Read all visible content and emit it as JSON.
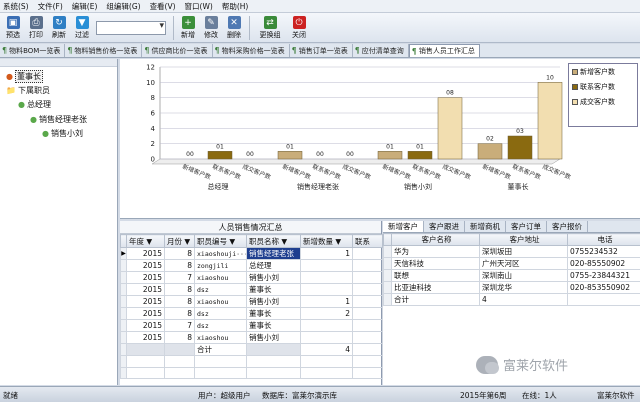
{
  "menu": [
    "系统(S)",
    "文件(F)",
    "编辑(E)",
    "组编辑(G)",
    "查看(V)",
    "窗口(W)",
    "帮助(H)"
  ],
  "toolbar": [
    {
      "label": "预选",
      "icon": "preview-icon",
      "color": "#3b6fb5"
    },
    {
      "label": "打印",
      "icon": "printer-icon",
      "color": "#5a6f8c"
    },
    {
      "label": "刷新",
      "icon": "refresh-icon",
      "color": "#2f7fc4"
    },
    {
      "label": "过滤",
      "icon": "filter-icon",
      "color": "#2a8fd6"
    },
    {
      "label": "新增",
      "icon": "add-icon",
      "color": "#3b8f3b"
    },
    {
      "label": "修改",
      "icon": "edit-icon",
      "color": "#6a7f9c"
    },
    {
      "label": "删除",
      "icon": "delete-icon",
      "color": "#4f79b3"
    },
    {
      "label": "更换组",
      "icon": "swap-group-icon",
      "color": "#3a8a3a"
    },
    {
      "label": "关闭",
      "icon": "close-icon",
      "color": "#cc2222"
    }
  ],
  "tabs": [
    {
      "label": "物料BOM一览表",
      "active": false
    },
    {
      "label": "物料销售价格一览表",
      "active": false
    },
    {
      "label": "供应商比价一览表",
      "active": false
    },
    {
      "label": "物料采购价格一览表",
      "active": false
    },
    {
      "label": "销售订单一览表",
      "active": false
    },
    {
      "label": "应付清单查询",
      "active": false
    },
    {
      "label": "销售人员工作汇总",
      "active": true
    }
  ],
  "tree": [
    {
      "label": "董事长",
      "level": 0,
      "selected": true
    },
    {
      "label": "下属职员",
      "level": 0,
      "selected": false
    },
    {
      "label": "总经理",
      "level": 1,
      "selected": false
    },
    {
      "label": "销售经理老张",
      "level": 2,
      "selected": false
    },
    {
      "label": "销售小刘",
      "level": 3,
      "selected": false
    }
  ],
  "chart_data": {
    "type": "bar",
    "ylim": [
      0,
      12
    ],
    "yticks": [
      0,
      2,
      4,
      6,
      8,
      10,
      12
    ],
    "categories": [
      "总经理",
      "销售经理老张",
      "销售小刘",
      "董事长"
    ],
    "series": [
      {
        "name": "新增客户数",
        "color": "#c9ad7a",
        "values": [
          0,
          1,
          1,
          2
        ]
      },
      {
        "name": "联系客户数",
        "color": "#8a6a10",
        "values": [
          1,
          0,
          1,
          3
        ]
      },
      {
        "name": "成交客户数",
        "color": "#f2deb0",
        "values": [
          0,
          0,
          8,
          10
        ]
      }
    ],
    "value_labels": [
      [
        "00",
        "01",
        "00"
      ],
      [
        "01",
        "00",
        "00"
      ],
      [
        "01",
        "01",
        "08"
      ],
      [
        "02",
        "03",
        "10"
      ]
    ],
    "legend_position": "top-right"
  },
  "left_table": {
    "title": "人员销售情况汇总",
    "columns": [
      "年度",
      "月份",
      "职员编号",
      "职员名称",
      "新增数量",
      "联系"
    ],
    "rows": [
      [
        "2015",
        "8",
        "xiaoshouji···",
        "销售经理老张",
        "1",
        ""
      ],
      [
        "2015",
        "8",
        "zongjili",
        "总经理",
        "",
        ""
      ],
      [
        "2015",
        "7",
        "xiaoshou",
        "销售小刘",
        "",
        ""
      ],
      [
        "2015",
        "8",
        "dsz",
        "董事长",
        "",
        ""
      ],
      [
        "2015",
        "8",
        "xiaoshou",
        "销售小刘",
        "1",
        ""
      ],
      [
        "2015",
        "8",
        "dsz",
        "董事长",
        "2",
        ""
      ],
      [
        "2015",
        "7",
        "dsz",
        "董事长",
        "",
        ""
      ],
      [
        "2015",
        "8",
        "xiaoshou",
        "销售小刘",
        "",
        ""
      ]
    ],
    "total_label": "合计",
    "total_value": "4"
  },
  "right_tabs": [
    {
      "label": "新增客户",
      "active": true
    },
    {
      "label": "客户跟进",
      "active": false
    },
    {
      "label": "新增商机",
      "active": false
    },
    {
      "label": "客户订单",
      "active": false
    },
    {
      "label": "客户报价",
      "active": false
    }
  ],
  "right_table": {
    "columns": [
      "客户名称",
      "客户地址",
      "电话"
    ],
    "rows": [
      [
        "华为",
        "深圳坂田",
        "0755234532"
      ],
      [
        "天信科技",
        "广州天河区",
        "020-85550902"
      ],
      [
        "联想",
        "深圳南山",
        "0755-23844321"
      ],
      [
        "比亚迪科技",
        "深圳龙华",
        "020-853550902"
      ]
    ],
    "total_label": "合计",
    "total_value": "4"
  },
  "status": {
    "left": "就绪",
    "user": "用户：超级用户",
    "db": "数据库：富莱尔演示库",
    "week": "2015年第6周",
    "online": "在线：1人",
    "company": "富莱尔软件"
  },
  "watermark": "富莱尔软件"
}
